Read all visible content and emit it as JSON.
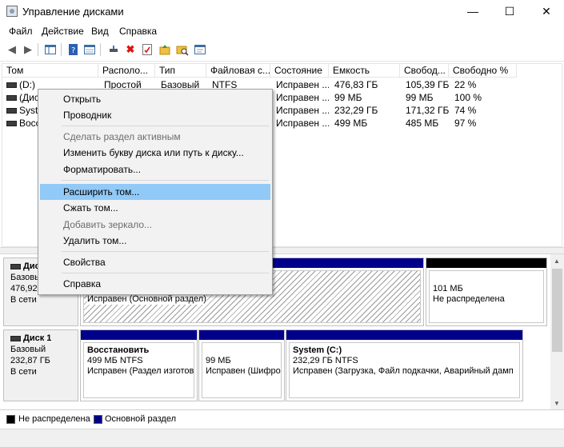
{
  "window": {
    "title": "Управление дисками",
    "min": "—",
    "max": "☐",
    "close": "✕"
  },
  "menubar": [
    "Файл",
    "Действие",
    "Вид",
    "Справка"
  ],
  "list": {
    "columns": [
      "Том",
      "Располо...",
      "Тип",
      "Файловая с...",
      "Состояние",
      "Емкость",
      "Свобод...",
      "Свободно %"
    ],
    "rows": [
      [
        "(D:)",
        "Простой",
        "Базовый",
        "NTFS",
        "Исправен ...",
        "476,83 ГБ",
        "105,39 ГБ",
        "22 %"
      ],
      [
        "(Дис",
        "",
        "",
        "",
        "Исправен ...",
        "99 МБ",
        "99 МБ",
        "100 %"
      ],
      [
        "Syste",
        "",
        "",
        "",
        "Исправен ...",
        "232,29 ГБ",
        "171,32 ГБ",
        "74 %"
      ],
      [
        "Восс",
        "",
        "",
        "",
        "Исправен ...",
        "499 МБ",
        "485 МБ",
        "97 %"
      ]
    ]
  },
  "disk0": {
    "name": "Дис",
    "type": "Базовы",
    "size": "476,92",
    "state": "В сети",
    "main_status": "Исправен (Основной раздел)",
    "unalloc_size": "101 МБ",
    "unalloc_label": "Не распределена"
  },
  "disk1": {
    "name": "Диск 1",
    "type": "Базовый",
    "size": "232,87 ГБ",
    "state": "В сети",
    "parts": [
      {
        "title": "Восстановить",
        "line1": "499 МБ NTFS",
        "line2": "Исправен (Раздел изготов"
      },
      {
        "title": "",
        "line1": "99 МБ",
        "line2": "Исправен (Шифро"
      },
      {
        "title": "System  (C:)",
        "line1": "232,29 ГБ NTFS",
        "line2": "Исправен (Загрузка, Файл подкачки, Аварийный дамп"
      }
    ]
  },
  "legend": {
    "unallocated": "Не распределена",
    "primary": "Основной раздел"
  },
  "context_menu": {
    "open": "Открыть",
    "explorer": "Проводник",
    "make_active": "Сделать раздел активным",
    "change_letter": "Изменить букву диска или путь к диску...",
    "format": "Форматировать...",
    "extend": "Расширить том...",
    "shrink": "Сжать том...",
    "add_mirror": "Добавить зеркало...",
    "delete": "Удалить том...",
    "properties": "Свойства",
    "help": "Справка"
  },
  "colors": {
    "primary_partition": "#00008b",
    "unallocated": "#000000",
    "highlight": "#91c9f7"
  }
}
